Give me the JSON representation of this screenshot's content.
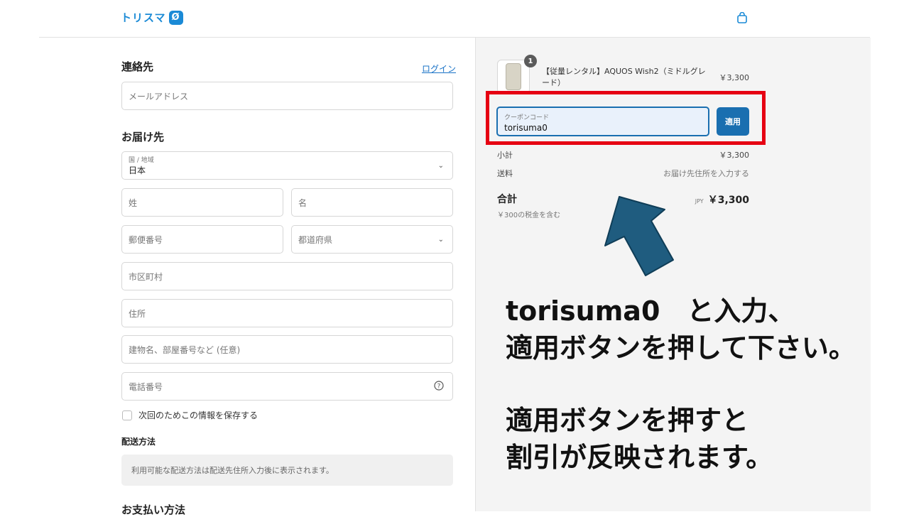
{
  "header": {
    "logo_text": "トリスマ",
    "logo_mark": "Ø",
    "bag_icon": "shopping-bag-icon",
    "accent_color": "#1a8ad6"
  },
  "contact": {
    "title": "連絡先",
    "login_link": "ログイン",
    "email_placeholder": "メールアドレス"
  },
  "shipping": {
    "title": "お届け先",
    "country_label": "国 / 地域",
    "country_value": "日本",
    "last_name": "姓",
    "first_name": "名",
    "postal_code": "郵便番号",
    "prefecture": "都道府県",
    "city": "市区町村",
    "address": "住所",
    "building": "建物名、部屋番号など (任意)",
    "phone": "電話番号",
    "save_info": "次回のためこの情報を保存する"
  },
  "delivery": {
    "title": "配送方法",
    "message": "利用可能な配送方法は配送先住所入力後に表示されます。"
  },
  "payment": {
    "title": "お支払い方法"
  },
  "summary": {
    "item_name": "【従量レンタル】AQUOS Wish2（ミドルグレード）",
    "item_qty": "1",
    "item_price": "￥3,300",
    "coupon_label": "クーポンコード",
    "coupon_value": "torisuma0",
    "apply_label": "適用",
    "subtotal_label": "小計",
    "subtotal_value": "￥3,300",
    "shipping_label": "送料",
    "shipping_value": "お届け先住所を入力する",
    "total_label": "合計",
    "currency": "JPY",
    "total_value": "￥3,300",
    "tax_note": "￥300の税金を含む"
  },
  "annotation": {
    "line1": "torisuma0　と入力、",
    "line2": "適用ボタンを押して下さい。",
    "line3": "適用ボタンを押すと",
    "line4": "割引が反映されます。",
    "highlight_color": "#e60012",
    "arrow_color": "#1f5c7f"
  }
}
